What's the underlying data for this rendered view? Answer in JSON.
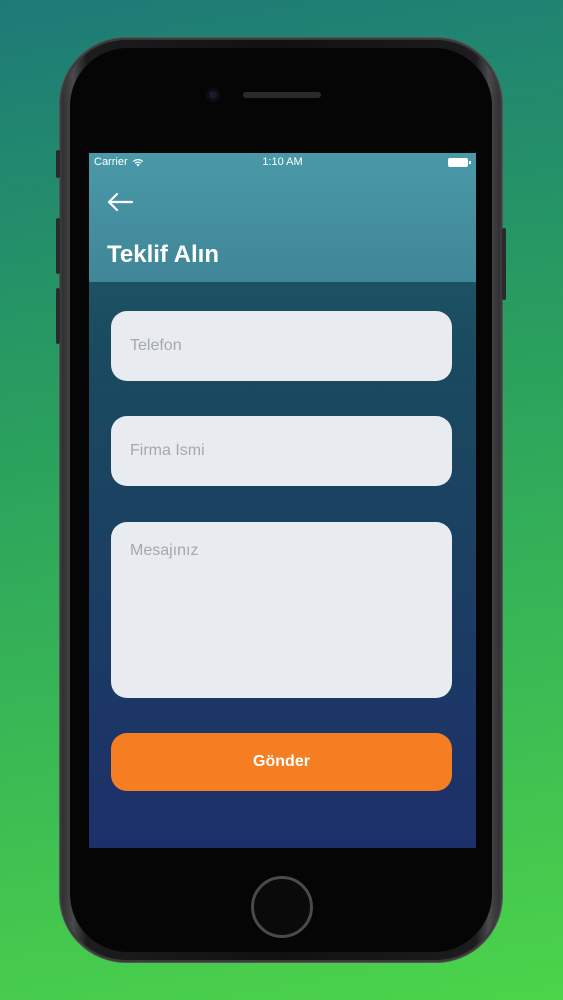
{
  "status_bar": {
    "carrier": "Carrier",
    "time": "1:10 AM"
  },
  "header": {
    "title": "Teklif Alın",
    "back_icon": "arrow-left-icon"
  },
  "form": {
    "phone_placeholder": "Telefon",
    "company_placeholder": "Firma İsmi",
    "message_placeholder": "Mesajınız",
    "submit_label": "Gönder"
  },
  "colors": {
    "accent": "#f67e22",
    "header": "#4a99a8",
    "field_bg": "#e8ebef"
  }
}
